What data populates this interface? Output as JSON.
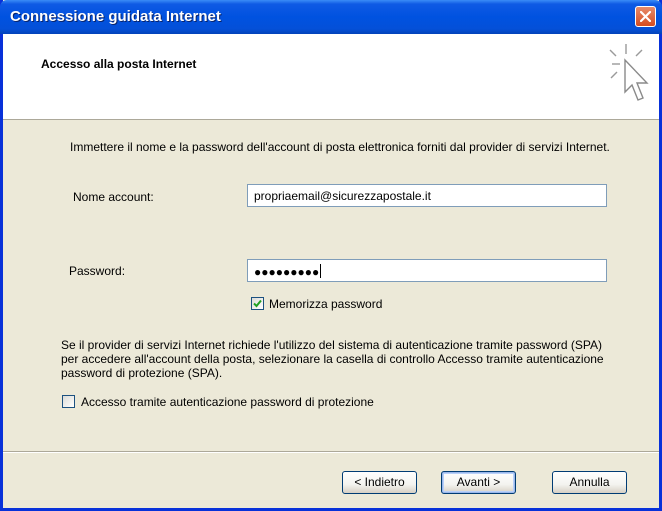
{
  "window": {
    "title": "Connessione guidata Internet"
  },
  "header": {
    "title": "Accesso alla posta Internet"
  },
  "intro": "Immettere il nome e la password dell'account di posta elettronica forniti dal provider di servizi Internet.",
  "account": {
    "label": "Nome account:",
    "value": "propriaemail@sicurezzapostale.it"
  },
  "password": {
    "label": "Password:",
    "masked_value": "●●●●●●●●●"
  },
  "remember": {
    "label": "Memorizza password",
    "checked": true
  },
  "spa": {
    "description": "Se il provider di servizi Internet richiede l'utilizzo del sistema di autenticazione tramite password (SPA) per accedere all'account della posta, selezionare la casella di controllo Accesso tramite autenticazione password di protezione (SPA).",
    "checkbox_label": "Accesso tramite autenticazione password di protezione",
    "checked": false
  },
  "buttons": {
    "back": "< Indietro",
    "next": "Avanti >",
    "cancel": "Annulla"
  },
  "colors": {
    "titlebar": "#0052E0",
    "dialog_bg": "#ECE9D8",
    "close": "#D54C20"
  },
  "icons": {
    "close": "close-icon",
    "wizard": "wizard-cursor-icon",
    "check": "checkmark-icon"
  }
}
